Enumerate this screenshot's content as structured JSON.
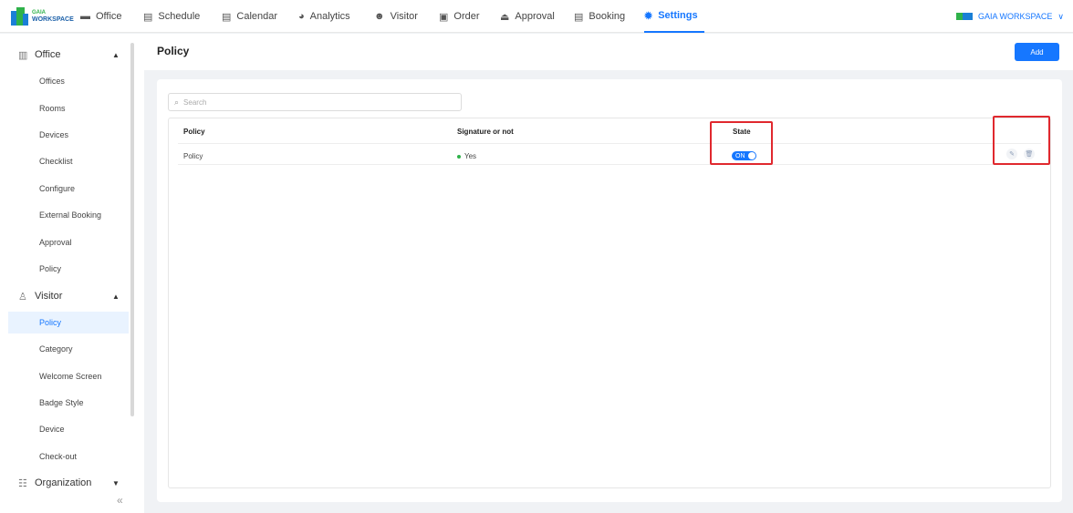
{
  "app": {
    "logo": {
      "line1": "GAIA",
      "line2": "WORKSPACE"
    },
    "brand_right": "GAIA WORKSPACE"
  },
  "nav": [
    {
      "label": "Office",
      "icon": "office-icon"
    },
    {
      "label": "Schedule",
      "icon": "schedule-icon"
    },
    {
      "label": "Calendar",
      "icon": "calendar-icon"
    },
    {
      "label": "Analytics",
      "icon": "analytics-icon"
    },
    {
      "label": "Visitor",
      "icon": "visitor-icon"
    },
    {
      "label": "Order",
      "icon": "order-icon"
    },
    {
      "label": "Approval",
      "icon": "approval-icon"
    },
    {
      "label": "Booking",
      "icon": "booking-icon"
    },
    {
      "label": "Settings",
      "icon": "settings-icon",
      "active": true
    }
  ],
  "sidebar": {
    "office": {
      "label": "Office",
      "items": [
        "Offices",
        "Rooms",
        "Devices",
        "Checklist",
        "Configure",
        "External Booking",
        "Approval",
        "Policy"
      ]
    },
    "visitor": {
      "label": "Visitor",
      "items": [
        "Policy",
        "Category",
        "Welcome Screen",
        "Badge Style",
        "Device",
        "Check-out"
      ],
      "active_item": "Policy"
    },
    "organization": {
      "label": "Organization"
    }
  },
  "page": {
    "title": "Policy",
    "add_label": "Add",
    "search_placeholder": "Search"
  },
  "table": {
    "columns": [
      "Policy",
      "Signature or not",
      "State"
    ],
    "rows": [
      {
        "policy": "Policy",
        "signature": "Yes",
        "state": "ON"
      }
    ]
  },
  "colors": {
    "accent": "#1677ff",
    "highlight": "#e0282e",
    "status_yes": "#2fb24a"
  }
}
